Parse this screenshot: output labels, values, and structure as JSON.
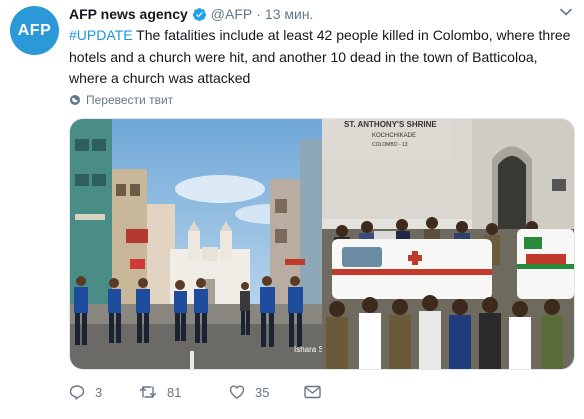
{
  "tweet": {
    "avatar_text": "AFP",
    "name": "AFP news agency",
    "handle": "@AFP",
    "separator": "·",
    "time": "13 мин.",
    "hashtag": "#UPDATE",
    "body": " The fatalities include at least 42 people killed in Colombo, where three hotels and a church were hit, and another 10 dead in the town of Batticoloa, where a church was attacked",
    "translate_label": "Перевести твит"
  },
  "photos": {
    "left_credit": "Ishara S",
    "right_sign_line1": "ST. ANTHONY'S SHRINE",
    "right_sign_line2": "KOCHCHIKADE",
    "right_sign_line3": "COLOMBO - 13"
  },
  "actions": {
    "reply_count": "3",
    "retweet_count": "81",
    "like_count": "35"
  },
  "colors": {
    "accent": "#1b95e0",
    "avatar": "#2b98d8",
    "muted": "#657786"
  }
}
